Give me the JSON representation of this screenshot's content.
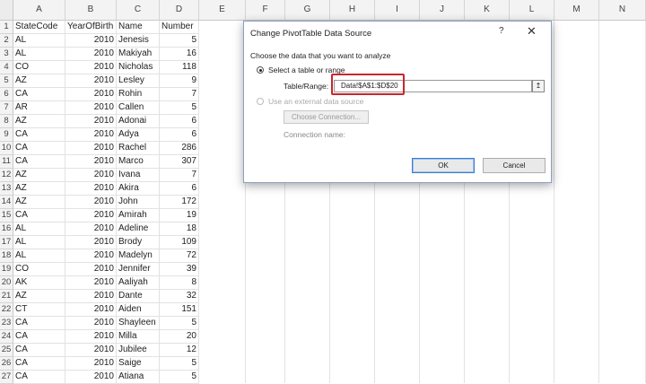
{
  "sheet": {
    "columns": [
      "A",
      "B",
      "C",
      "D",
      "E",
      "F",
      "G",
      "H",
      "I",
      "J",
      "K",
      "L",
      "M",
      "N"
    ],
    "rows": [
      {
        "n": "1",
        "a": "StateCode",
        "b": "YearOfBirth",
        "c": "Name",
        "d": "Number"
      },
      {
        "n": "2",
        "a": "AL",
        "b": "2010",
        "c": "Jenesis",
        "d": "5"
      },
      {
        "n": "3",
        "a": "AL",
        "b": "2010",
        "c": "Makiyah",
        "d": "16"
      },
      {
        "n": "4",
        "a": "CO",
        "b": "2010",
        "c": "Nicholas",
        "d": "118"
      },
      {
        "n": "5",
        "a": "AZ",
        "b": "2010",
        "c": "Lesley",
        "d": "9"
      },
      {
        "n": "6",
        "a": "CA",
        "b": "2010",
        "c": "Rohin",
        "d": "7"
      },
      {
        "n": "7",
        "a": "AR",
        "b": "2010",
        "c": "Callen",
        "d": "5"
      },
      {
        "n": "8",
        "a": "AZ",
        "b": "2010",
        "c": "Adonai",
        "d": "6"
      },
      {
        "n": "9",
        "a": "CA",
        "b": "2010",
        "c": "Adya",
        "d": "6"
      },
      {
        "n": "10",
        "a": "CA",
        "b": "2010",
        "c": "Rachel",
        "d": "286"
      },
      {
        "n": "11",
        "a": "CA",
        "b": "2010",
        "c": "Marco",
        "d": "307"
      },
      {
        "n": "12",
        "a": "AZ",
        "b": "2010",
        "c": "Ivana",
        "d": "7"
      },
      {
        "n": "13",
        "a": "AZ",
        "b": "2010",
        "c": "Akira",
        "d": "6"
      },
      {
        "n": "14",
        "a": "AZ",
        "b": "2010",
        "c": "John",
        "d": "172"
      },
      {
        "n": "15",
        "a": "CA",
        "b": "2010",
        "c": "Amirah",
        "d": "19"
      },
      {
        "n": "16",
        "a": "AL",
        "b": "2010",
        "c": "Adeline",
        "d": "18"
      },
      {
        "n": "17",
        "a": "AL",
        "b": "2010",
        "c": "Brody",
        "d": "109"
      },
      {
        "n": "18",
        "a": "AL",
        "b": "2010",
        "c": "Madelyn",
        "d": "72"
      },
      {
        "n": "19",
        "a": "CO",
        "b": "2010",
        "c": "Jennifer",
        "d": "39"
      },
      {
        "n": "20",
        "a": "AK",
        "b": "2010",
        "c": "Aaliyah",
        "d": "8"
      },
      {
        "n": "21",
        "a": "AZ",
        "b": "2010",
        "c": "Dante",
        "d": "32"
      },
      {
        "n": "22",
        "a": "CT",
        "b": "2010",
        "c": "Aiden",
        "d": "151"
      },
      {
        "n": "23",
        "a": "CA",
        "b": "2010",
        "c": "Shayleen",
        "d": "5"
      },
      {
        "n": "24",
        "a": "CA",
        "b": "2010",
        "c": "Milla",
        "d": "20"
      },
      {
        "n": "25",
        "a": "CA",
        "b": "2010",
        "c": "Jubilee",
        "d": "12"
      },
      {
        "n": "26",
        "a": "CA",
        "b": "2010",
        "c": "Saige",
        "d": "5"
      },
      {
        "n": "27",
        "a": "CA",
        "b": "2010",
        "c": "Atiana",
        "d": "5"
      }
    ]
  },
  "dialog": {
    "title": "Change PivotTable Data Source",
    "help_label": "?",
    "close_label": "✕",
    "instruction": "Choose the data that you want to analyze",
    "option_table": "Select a table or range",
    "range_label": "Table/Range:",
    "range_value": "Data!$A$1:$D$20",
    "collapse_icon": "↥",
    "option_external": "Use an external data source",
    "choose_connection": "Choose Connection...",
    "connection_name_label": "Connection name:",
    "ok": "OK",
    "cancel": "Cancel",
    "highlight_color": "#c8262e"
  }
}
